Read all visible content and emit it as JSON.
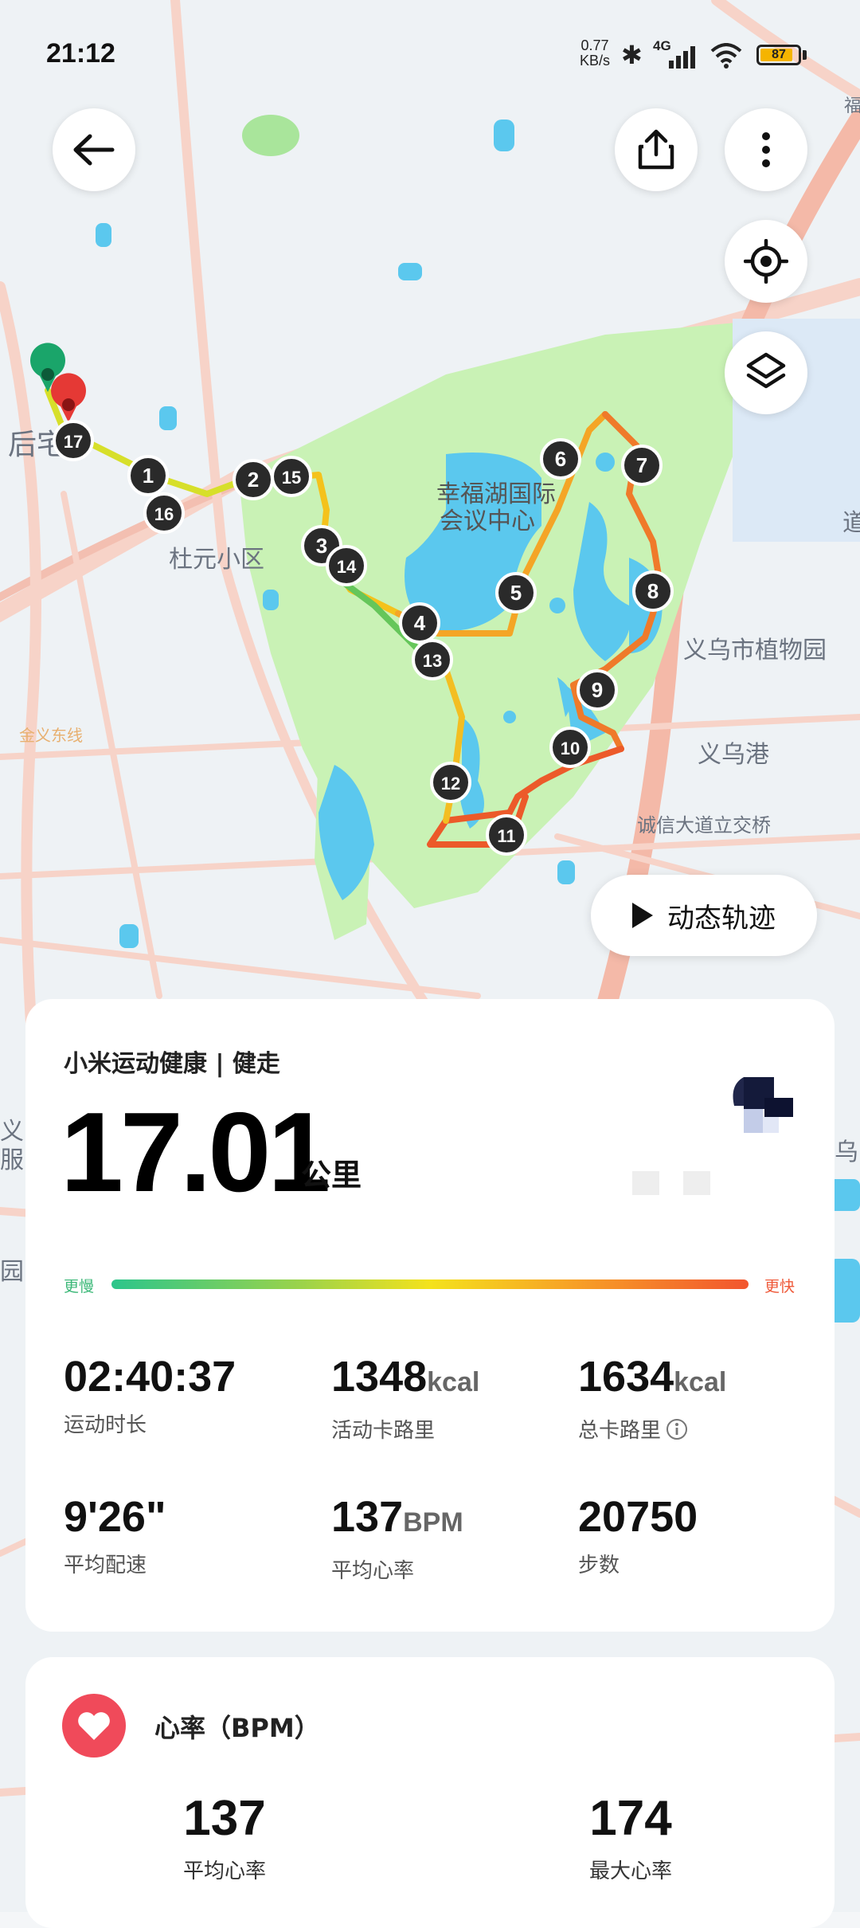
{
  "status_bar": {
    "time": "21:12",
    "net_speed_value": "0.77",
    "net_speed_unit": "KB/s",
    "network": "4G",
    "battery": "87",
    "battery_level": 0.87
  },
  "map": {
    "labels": {
      "center": "幸福湖国际\n会议中心",
      "duyuan": "杜元小区",
      "houzhai": "后宅",
      "botanical": "义乌市植物园",
      "port": "义乌港",
      "interchange": "诚信大道立交桥",
      "metro": "金义东线",
      "edge_left_1": "义",
      "edge_left_2": "服",
      "edge_left_3": "园区",
      "edge_right_1": "乌",
      "edge_right_2": "道",
      "edge_right_3": "福"
    },
    "km_markers": [
      "1",
      "2",
      "3",
      "4",
      "5",
      "6",
      "7",
      "8",
      "9",
      "10",
      "11",
      "12",
      "13",
      "14",
      "15",
      "16",
      "17"
    ],
    "colors": {
      "park": "#c9f2b5",
      "water": "#5bc8ee",
      "road": "#f6c9bd",
      "land": "#eef2f5"
    }
  },
  "buttons": {
    "back_icon": "arrow-left-icon",
    "share_icon": "share-icon",
    "more_icon": "more-vertical-icon",
    "locate_icon": "locate-icon",
    "layers_icon": "layers-icon",
    "play_icon": "play-icon",
    "dynamic_track": "动态轨迹"
  },
  "summary": {
    "source": "小米运动健康 | 健走",
    "distance": "17.01",
    "distance_unit": "公里",
    "slower": "更慢",
    "faster": "更快",
    "metrics": [
      {
        "value": "02:40:37",
        "unit": "",
        "label": "运动时长"
      },
      {
        "value": "1348",
        "unit": "kcal",
        "label": "活动卡路里"
      },
      {
        "value": "1634",
        "unit": "kcal",
        "label": "总卡路里"
      },
      {
        "value": "9'26\"",
        "unit": "",
        "label": "平均配速"
      },
      {
        "value": "137",
        "unit": "BPM",
        "label": "平均心率"
      },
      {
        "value": "20750",
        "unit": "",
        "label": "步数"
      }
    ]
  },
  "heart_rate": {
    "title": "心率（BPM）",
    "avg_value": "137",
    "avg_label": "平均心率",
    "max_value": "174",
    "max_label": "最大心率"
  }
}
